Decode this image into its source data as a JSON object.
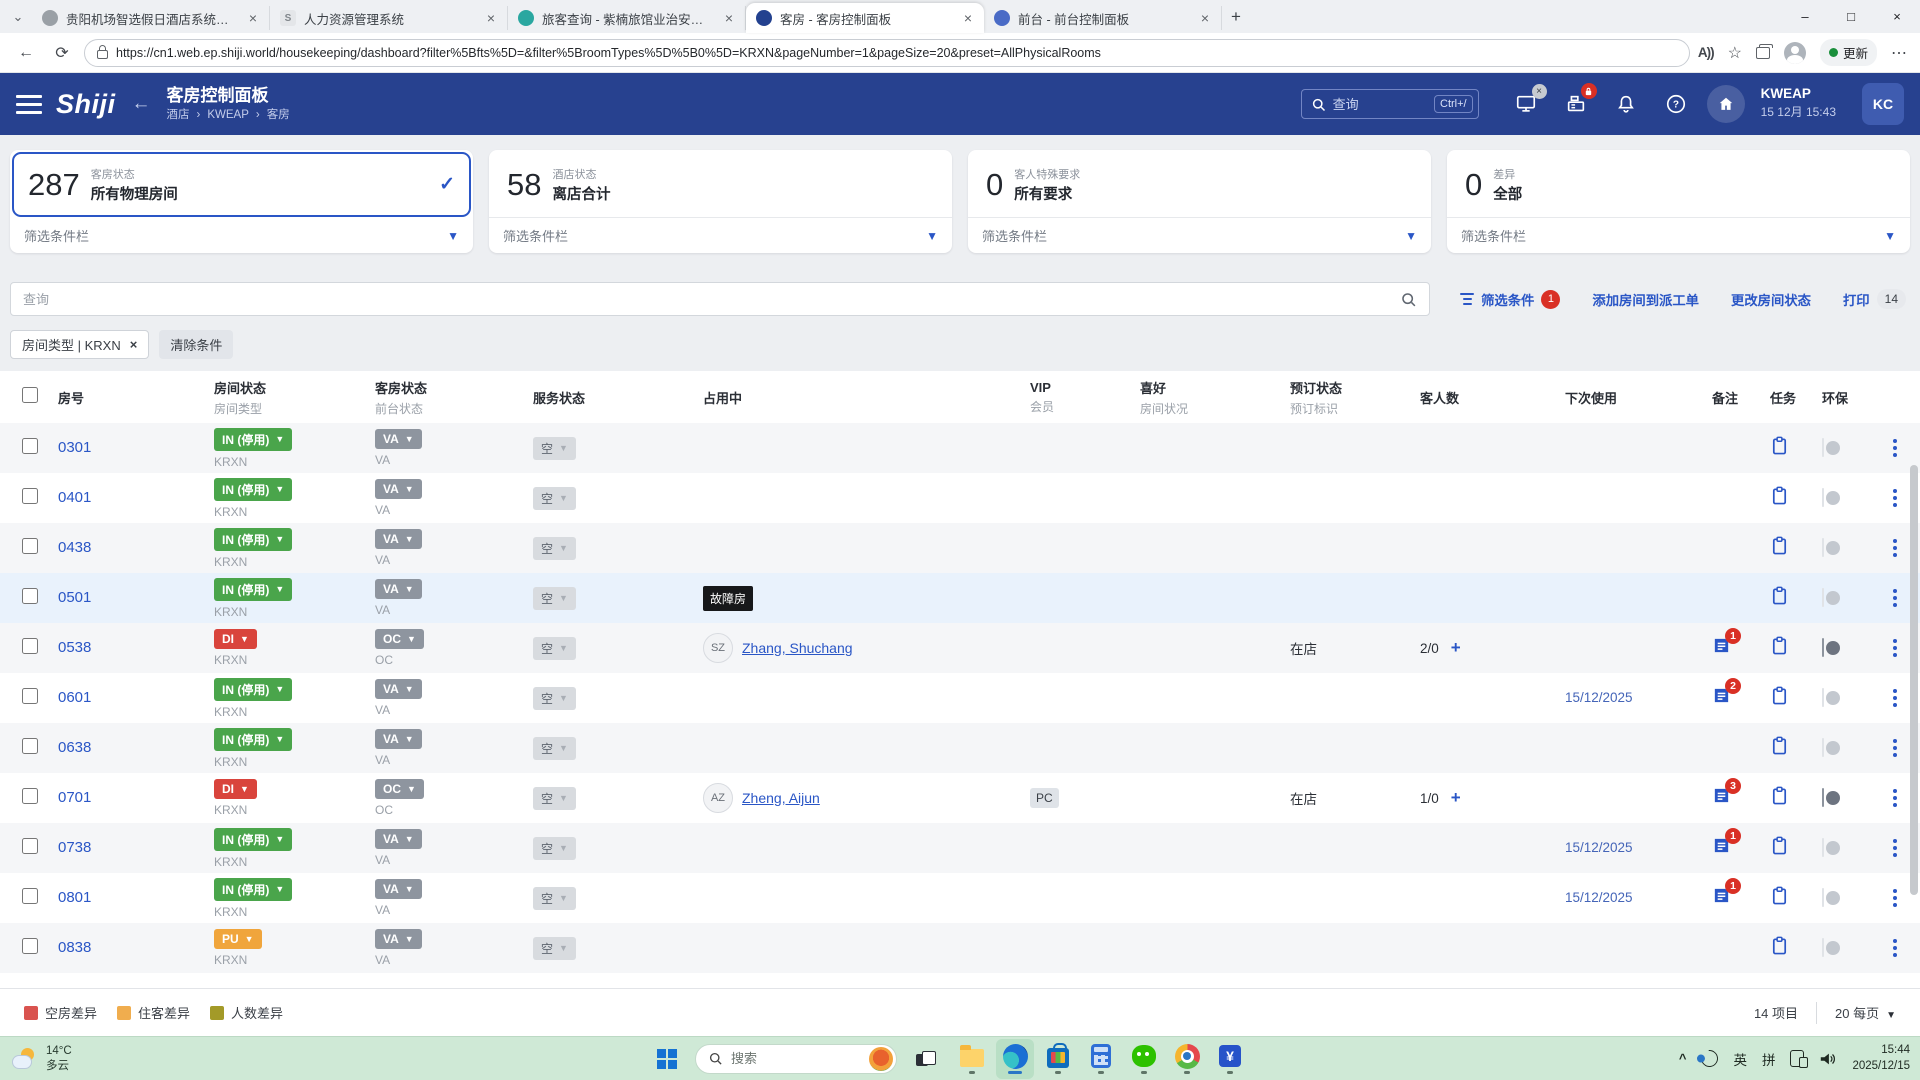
{
  "colors": {
    "header_blue": "#27418f",
    "accent_blue": "#2a56c6",
    "status_green": "#4aa54b",
    "status_red": "#d9443c",
    "status_orange": "#f0a53c",
    "badge_red": "#d93025"
  },
  "browser": {
    "tabs": [
      {
        "title": "贵阳机场智选假日酒店系统网址...",
        "icon": "globe-favicon",
        "active": false
      },
      {
        "title": "人力资源管理系统",
        "icon": "shiji-favicon",
        "active": false
      },
      {
        "title": "旅客查询 - 紫楠旅馆业治安信息管...",
        "icon": "teal-circle-favicon",
        "active": false
      },
      {
        "title": "客房 - 客房控制面板",
        "icon": "darkblue-circle-favicon",
        "active": true
      },
      {
        "title": "前台 - 前台控制面板",
        "icon": "blue-circle-favicon",
        "active": false
      }
    ],
    "url": "https://cn1.web.ep.shiji.world/housekeeping/dashboard?filter%5Bfts%5D=&filter%5BroomTypes%5D%5B0%5D=KRXN&pageNumber=1&pageSize=20&preset=AllPhysicalRooms",
    "update_label": "更新"
  },
  "header": {
    "logo": "Shiji",
    "title": "客房控制面板",
    "breadcrumb": [
      "酒店",
      "KWEAP",
      "客房"
    ],
    "search_placeholder": "查询",
    "search_shortcut": "Ctrl+/",
    "property_code": "KWEAP",
    "datetime": "15 12月 15:43",
    "avatar_initials": "KC"
  },
  "cards": [
    {
      "value": "287",
      "category": "客房状态",
      "label": "所有物理房间",
      "selected": true,
      "filter_label": "筛选条件栏"
    },
    {
      "value": "58",
      "category": "酒店状态",
      "label": "离店合计",
      "selected": false,
      "filter_label": "筛选条件栏"
    },
    {
      "value": "0",
      "category": "客人特殊要求",
      "label": "所有要求",
      "selected": false,
      "filter_label": "筛选条件栏"
    },
    {
      "value": "0",
      "category": "差异",
      "label": "全部",
      "selected": false,
      "filter_label": "筛选条件栏"
    }
  ],
  "toolbar": {
    "search_placeholder": "查询",
    "actions": [
      {
        "label": "筛选条件",
        "badge": "1",
        "badge_style": "red",
        "icon": "filter-icon"
      },
      {
        "label": "添加房间到派工单",
        "badge": "",
        "badge_style": "",
        "icon": ""
      },
      {
        "label": "更改房间状态",
        "badge": "",
        "badge_style": "",
        "icon": ""
      },
      {
        "label": "打印",
        "badge": "14",
        "badge_style": "grey",
        "icon": ""
      }
    ],
    "chips": [
      {
        "label": "房间类型 | KRXN",
        "closable": true
      },
      {
        "label": "清除条件",
        "closable": false
      }
    ]
  },
  "table": {
    "columns": [
      {
        "title": "房号",
        "sub": ""
      },
      {
        "title": "房间状态",
        "sub": "房间类型"
      },
      {
        "title": "客房状态",
        "sub": "前台状态"
      },
      {
        "title": "服务状态",
        "sub": ""
      },
      {
        "title": "占用中",
        "sub": ""
      },
      {
        "title": "VIP",
        "sub": "会员"
      },
      {
        "title": "喜好",
        "sub": "房间状况"
      },
      {
        "title": "预订状态",
        "sub": "预订标识"
      },
      {
        "title": "客人数",
        "sub": ""
      },
      {
        "title": "下次使用",
        "sub": ""
      },
      {
        "title": "备注",
        "sub": ""
      },
      {
        "title": "任务",
        "sub": ""
      },
      {
        "title": "环保",
        "sub": ""
      }
    ],
    "rows": [
      {
        "room": "0301",
        "room_status": "IN (停用)",
        "status_color": "green",
        "room_type": "KRXN",
        "front_status": "VA",
        "front_sub": "VA",
        "service_status": "空",
        "ooo_badge": "",
        "occupant_initials": "",
        "occupant_name": "",
        "vip_badge": "",
        "reservation_status": "",
        "guest_count": "",
        "next_use": "",
        "notes_count": 0,
        "eco_on": false,
        "highlight": false
      },
      {
        "room": "0401",
        "room_status": "IN (停用)",
        "status_color": "green",
        "room_type": "KRXN",
        "front_status": "VA",
        "front_sub": "VA",
        "service_status": "空",
        "ooo_badge": "",
        "occupant_initials": "",
        "occupant_name": "",
        "vip_badge": "",
        "reservation_status": "",
        "guest_count": "",
        "next_use": "",
        "notes_count": 0,
        "eco_on": false,
        "highlight": false
      },
      {
        "room": "0438",
        "room_status": "IN (停用)",
        "status_color": "green",
        "room_type": "KRXN",
        "front_status": "VA",
        "front_sub": "VA",
        "service_status": "空",
        "ooo_badge": "",
        "occupant_initials": "",
        "occupant_name": "",
        "vip_badge": "",
        "reservation_status": "",
        "guest_count": "",
        "next_use": "",
        "notes_count": 0,
        "eco_on": false,
        "highlight": false
      },
      {
        "room": "0501",
        "room_status": "IN (停用)",
        "status_color": "green",
        "room_type": "KRXN",
        "front_status": "VA",
        "front_sub": "VA",
        "service_status": "空",
        "ooo_badge": "故障房",
        "occupant_initials": "",
        "occupant_name": "",
        "vip_badge": "",
        "reservation_status": "",
        "guest_count": "",
        "next_use": "",
        "notes_count": 0,
        "eco_on": false,
        "highlight": true
      },
      {
        "room": "0538",
        "room_status": "DI",
        "status_color": "red",
        "room_type": "KRXN",
        "front_status": "OC",
        "front_sub": "OC",
        "service_status": "空",
        "ooo_badge": "",
        "occupant_initials": "SZ",
        "occupant_name": "Zhang, Shuchang",
        "vip_badge": "",
        "reservation_status": "在店",
        "guest_count": "2/0",
        "next_use": "",
        "notes_count": 1,
        "eco_on": true,
        "highlight": false
      },
      {
        "room": "0601",
        "room_status": "IN (停用)",
        "status_color": "green",
        "room_type": "KRXN",
        "front_status": "VA",
        "front_sub": "VA",
        "service_status": "空",
        "ooo_badge": "",
        "occupant_initials": "",
        "occupant_name": "",
        "vip_badge": "",
        "reservation_status": "",
        "guest_count": "",
        "next_use": "15/12/2025",
        "notes_count": 2,
        "eco_on": false,
        "highlight": false
      },
      {
        "room": "0638",
        "room_status": "IN (停用)",
        "status_color": "green",
        "room_type": "KRXN",
        "front_status": "VA",
        "front_sub": "VA",
        "service_status": "空",
        "ooo_badge": "",
        "occupant_initials": "",
        "occupant_name": "",
        "vip_badge": "",
        "reservation_status": "",
        "guest_count": "",
        "next_use": "",
        "notes_count": 0,
        "eco_on": false,
        "highlight": false
      },
      {
        "room": "0701",
        "room_status": "DI",
        "status_color": "red",
        "room_type": "KRXN",
        "front_status": "OC",
        "front_sub": "OC",
        "service_status": "空",
        "ooo_badge": "",
        "occupant_initials": "AZ",
        "occupant_name": "Zheng, Aijun",
        "vip_badge": "PC",
        "reservation_status": "在店",
        "guest_count": "1/0",
        "next_use": "",
        "notes_count": 3,
        "eco_on": true,
        "highlight": false
      },
      {
        "room": "0738",
        "room_status": "IN (停用)",
        "status_color": "green",
        "room_type": "KRXN",
        "front_status": "VA",
        "front_sub": "VA",
        "service_status": "空",
        "ooo_badge": "",
        "occupant_initials": "",
        "occupant_name": "",
        "vip_badge": "",
        "reservation_status": "",
        "guest_count": "",
        "next_use": "15/12/2025",
        "notes_count": 1,
        "eco_on": false,
        "highlight": false
      },
      {
        "room": "0801",
        "room_status": "IN (停用)",
        "status_color": "green",
        "room_type": "KRXN",
        "front_status": "VA",
        "front_sub": "VA",
        "service_status": "空",
        "ooo_badge": "",
        "occupant_initials": "",
        "occupant_name": "",
        "vip_badge": "",
        "reservation_status": "",
        "guest_count": "",
        "next_use": "15/12/2025",
        "notes_count": 1,
        "eco_on": false,
        "highlight": false
      },
      {
        "room": "0838",
        "room_status": "PU",
        "status_color": "orange",
        "room_type": "KRXN",
        "front_status": "VA",
        "front_sub": "VA",
        "service_status": "空",
        "ooo_badge": "",
        "occupant_initials": "",
        "occupant_name": "",
        "vip_badge": "",
        "reservation_status": "",
        "guest_count": "",
        "next_use": "",
        "notes_count": 0,
        "eco_on": false,
        "highlight": false
      }
    ]
  },
  "legend": [
    {
      "label": "空房差异",
      "color": "#d9534f"
    },
    {
      "label": "住客差异",
      "color": "#f0ad4e"
    },
    {
      "label": "人数差异",
      "color": "#a39a28"
    }
  ],
  "pagination": {
    "items_label": "14 项目",
    "page_size_label": "20 每页"
  },
  "taskbar": {
    "weather_temp": "14°C",
    "weather_desc": "多云",
    "search_placeholder": "搜索",
    "ime_labels": [
      "英",
      "拼"
    ],
    "time": "15:44",
    "date": "2025/12/15",
    "apps": [
      {
        "name": "file-explorer",
        "active": false
      },
      {
        "name": "edge",
        "active": true
      },
      {
        "name": "store",
        "active": false
      },
      {
        "name": "calculator",
        "active": false
      },
      {
        "name": "wechat",
        "active": false
      },
      {
        "name": "chrome",
        "active": false
      },
      {
        "name": "bank",
        "active": false
      }
    ]
  }
}
